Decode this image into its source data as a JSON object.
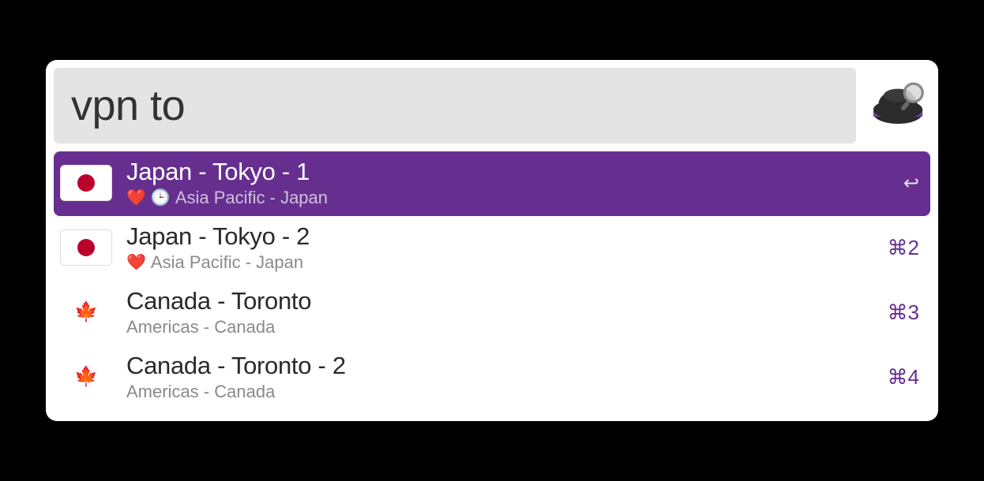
{
  "search": {
    "value": "vpn to",
    "placeholder": ""
  },
  "app_icon": {
    "name": "alfred-app-icon"
  },
  "results": [
    {
      "flag": "japan",
      "title": "Japan - Tokyo - 1",
      "badges": [
        "❤️",
        "🕒"
      ],
      "subtitle": "Asia Pacific - Japan",
      "shortcut": "↩",
      "selected": true
    },
    {
      "flag": "japan",
      "title": "Japan - Tokyo - 2",
      "badges": [
        "❤️"
      ],
      "subtitle": "Asia Pacific - Japan",
      "shortcut": "⌘2",
      "selected": false
    },
    {
      "flag": "canada",
      "title": "Canada - Toronto",
      "badges": [],
      "subtitle": "Americas - Canada",
      "shortcut": "⌘3",
      "selected": false
    },
    {
      "flag": "canada",
      "title": "Canada - Toronto - 2",
      "badges": [],
      "subtitle": "Americas - Canada",
      "shortcut": "⌘4",
      "selected": false
    }
  ],
  "colors": {
    "selection": "#662f8f",
    "shortcut": "#662f8f"
  }
}
